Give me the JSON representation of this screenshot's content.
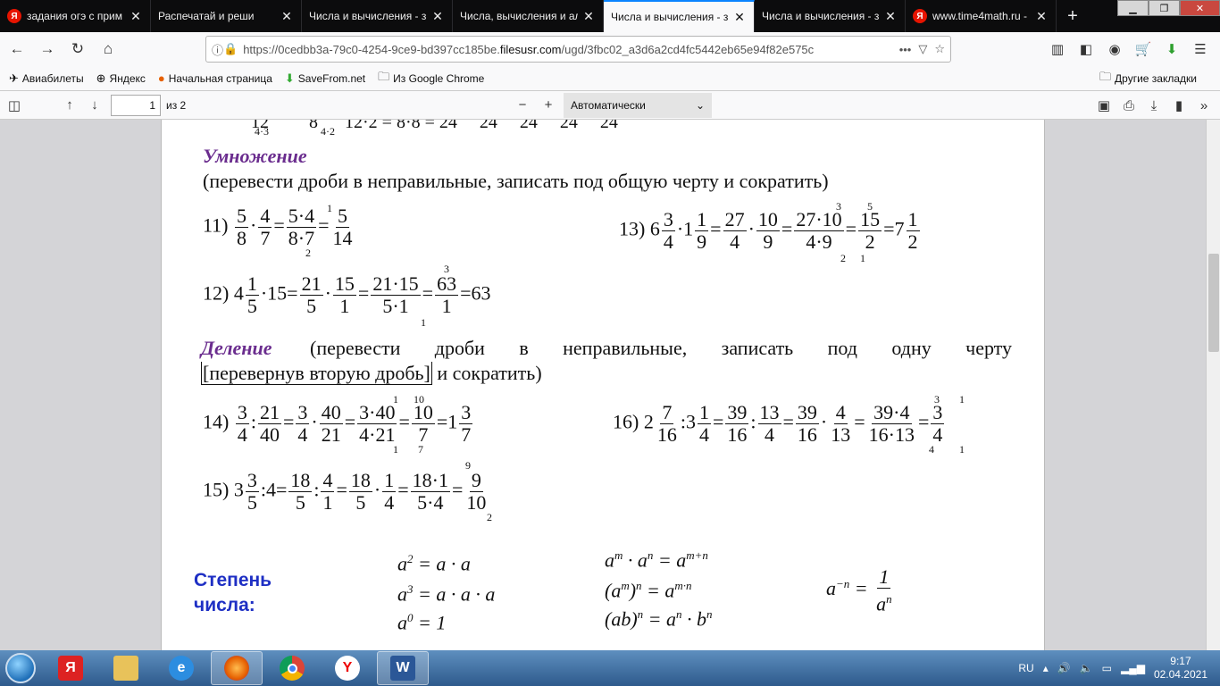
{
  "tabs": [
    {
      "title": "задания огэ с прим",
      "icon": "yandex-icon"
    },
    {
      "title": "Распечатай и реши",
      "icon": "page-icon"
    },
    {
      "title": "Числа и вычисления - з",
      "icon": "none"
    },
    {
      "title": "Числа, вычисления и ал",
      "icon": "none"
    },
    {
      "title": "Числа и вычисления - з",
      "icon": "none",
      "active": true
    },
    {
      "title": "Числа и вычисления - з",
      "icon": "none"
    },
    {
      "title": "www.time4math.ru -",
      "icon": "yandex-icon"
    }
  ],
  "url": {
    "prefix": "https://0cedbb3a-79c0-4254-9ce9-bd397cc185be.",
    "domain": "filesusr.com",
    "path": "/ugd/3fbc02_a3d6a2cd4fc5442eb65e94f82e575c"
  },
  "bookmarks": [
    "Авиабилеты",
    "Яндекс",
    "Начальная страница",
    "SaveFrom.net",
    "Из Google Chrome"
  ],
  "bookmarks_other": "Другие закладки",
  "pdf": {
    "page": "1",
    "of": "из 2",
    "zoom": "Автоматически"
  },
  "doc": {
    "mult_heading": "Умножение",
    "mult_desc": "(перевести дроби в неправильные, записать под общую черту и сократить)",
    "ex11": "11)",
    "ex12": "12)",
    "ex13": "13)",
    "div_heading": "Деление",
    "div_desc1": "(перевести дроби в неправильные, записать под одну черту",
    "div_desc2a": "[перевернув вторую дробь]",
    "div_desc2b": " и сократить)",
    "ex14": "14)",
    "ex15": "15)",
    "ex16": "16)",
    "power_heading1": "Степень",
    "power_heading2": "числа:"
  },
  "taskbar": {
    "lang": "RU",
    "time": "9:17",
    "date": "02.04.2021"
  }
}
